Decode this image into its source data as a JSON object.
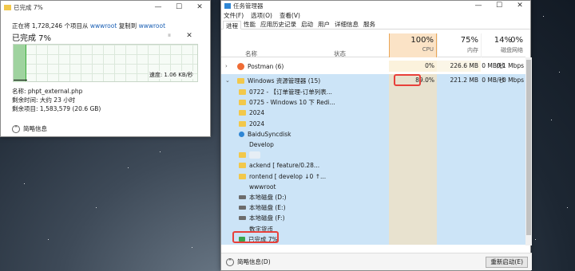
{
  "copy_dialog": {
    "title": "已完成 7%",
    "status_pre": "正在将 1,728,246 个项目从",
    "source": "wwwroot",
    "status_mid": "复制到",
    "dest": "wwwroot",
    "percent_label": "已完成 7%",
    "speed": "速度: 1.06 KB/秒",
    "file_name": "名称: phpt_external.php",
    "time_left": "剩余时间: 大约 23 小时",
    "items_left": "剩余项目: 1,583,579 (20.6 GB)",
    "details_label": "简略信息",
    "progress": 0.07,
    "pause_glyph": "⏸",
    "cancel_glyph": "✕"
  },
  "task_manager": {
    "title": "任务管理器",
    "menu": [
      "文件(F)",
      "选项(O)",
      "查看(V)"
    ],
    "tabs": [
      "进程",
      "性能",
      "应用历史记录",
      "启动",
      "用户",
      "详细信息",
      "服务"
    ],
    "headers": {
      "name": "名称",
      "status": "状态",
      "cpu_pct": "100%",
      "cpu": "CPU",
      "mem_pct": "75%",
      "mem": "内存",
      "disk_pct": "14%",
      "disk": "磁盘",
      "net_pct": "0%",
      "net": "网络"
    },
    "processes": [
      {
        "name": "Postman (6)",
        "cpu": "0%",
        "mem": "226.6 MB",
        "disk": "0 MB/秒",
        "net": "0.1 Mbps"
      },
      {
        "name": "Windows 资源管理器 (15)",
        "cpu": "89.0%",
        "mem": "221.2 MB",
        "disk": "0 MB/秒",
        "net": "0 Mbps"
      }
    ],
    "children": [
      "0722 - 【订单管理-订单列表...",
      "0725 - Windows 10 下 Redi...",
      "2024",
      "2024",
      "BaiduSyncdisk",
      "Develop",
      "",
      "ackend [ feature/0.28...",
      "rontend [ develop ↓0 ↑...",
      "wwwroot",
      "本地磁盘 (D:)",
      "本地磁盘 (E:)",
      "本地磁盘 (F:)",
      "数字货币",
      "已完成 7%"
    ],
    "footer_details": "简略信息(D)",
    "end_task": "重新启动(E)"
  }
}
